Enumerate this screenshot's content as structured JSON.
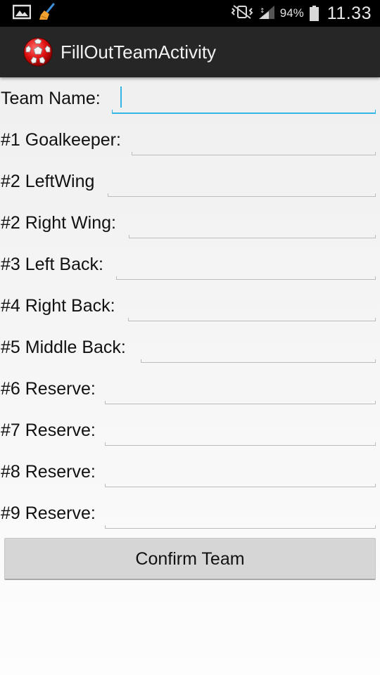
{
  "status_bar": {
    "icons": [
      "image-icon",
      "cleaner-broom-icon",
      "vibrate-silent-icon",
      "signal-icon",
      "battery-icon"
    ],
    "battery_percent": "94%",
    "time": "11.33"
  },
  "action_bar": {
    "app_icon": "soccer-ball-icon",
    "title": "FillOutTeamActivity"
  },
  "form": {
    "fields": [
      {
        "label": "Team Name:",
        "value": "",
        "focused": true
      },
      {
        "label": "#1 Goalkeeper:",
        "value": ""
      },
      {
        "label": "#2 LeftWing",
        "value": ""
      },
      {
        "label": "#2 Right Wing:",
        "value": ""
      },
      {
        "label": "#3 Left Back:",
        "value": ""
      },
      {
        "label": "#4 Right Back:",
        "value": ""
      },
      {
        "label": "#5 Middle Back:",
        "value": ""
      },
      {
        "label": "#6 Reserve:",
        "value": ""
      },
      {
        "label": "#7 Reserve:",
        "value": ""
      },
      {
        "label": "#8 Reserve:",
        "value": ""
      },
      {
        "label": "#9 Reserve:",
        "value": ""
      }
    ],
    "confirm_label": "Confirm Team"
  },
  "colors": {
    "accent": "#33b5e5",
    "action_bar_bg": "#262626",
    "status_bar_bg": "#000000",
    "button_bg": "#d6d6d6"
  }
}
